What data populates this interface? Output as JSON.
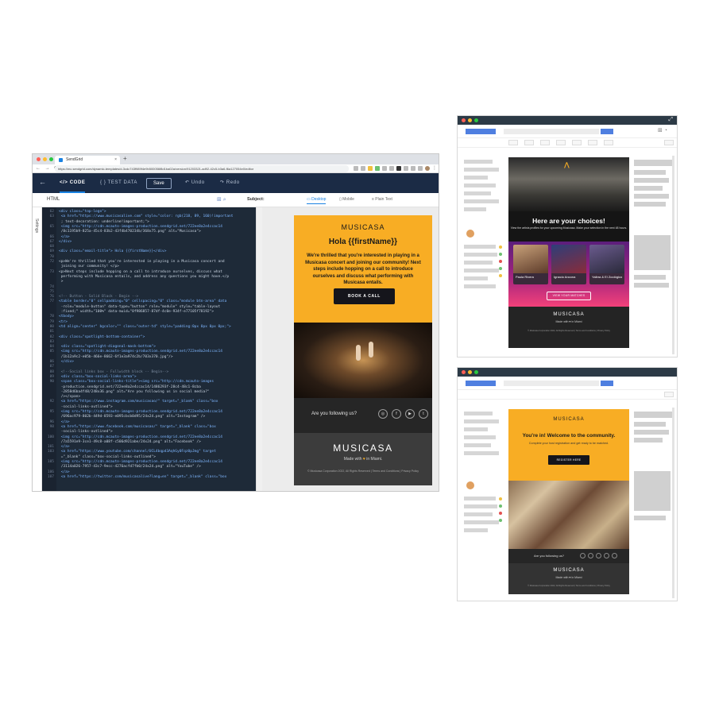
{
  "browser": {
    "tab_title": "SendGrid",
    "tab_close": "×",
    "new_tab": "+",
    "nav": "← → ⟳",
    "url": "https://mc.sendgrid.com/dynamic-templates/d-3cdc743f989f4e9b500056f8d1ba02a/version/91203321-ad92-42c5-b3a6-f6a127054e0/editor"
  },
  "toolbar": {
    "back": "←",
    "code_tab": "</>  CODE",
    "test_data_tab": "{ }  TEST DATA",
    "save_label": "Save",
    "undo_label": "↶  Undo",
    "redo_label": "↷  Redo"
  },
  "subbar": {
    "html_label": "HTML",
    "icons": "⊞  ⌕",
    "subject_label": "Subject:",
    "desktop": "▭  Desktop",
    "mobile": "▯  Mobile",
    "plain_text": "≡  Plain Text"
  },
  "settings_label": "Settings",
  "code_lines": [
    {
      "n": "62",
      "t": "<div class=\"top-logo\">",
      "k": "tag"
    },
    {
      "n": "63",
      "t": "  <a href=\"https://www.musicasalive.com\" style=\"color: rgb(218, 89, 160)!important",
      "k": "tag"
    },
    {
      "n": "",
      "t": "      ; text-decoration: underline!important;\">",
      "k": ""
    },
    {
      "n": "65",
      "t": "    <img src=\"http://cdn.mcauto-images-production.sendgrid.net/722ee8a2e4ccac14",
      "k": "tag"
    },
    {
      "n": "",
      "t": "      /8c1195b9-825a-45c4-83b2-43f4b470234b/368x75.png\" alt=\"Musicasa\">",
      "k": ""
    },
    {
      "n": "66",
      "t": "  </a>",
      "k": "tag"
    },
    {
      "n": "67",
      "t": "</div>",
      "k": "tag"
    },
    {
      "n": "68",
      "t": "",
      "k": ""
    },
    {
      "n": "69",
      "t": "<div class=\"email-title\"> Hola {{firstName}}</div>",
      "k": "tag"
    },
    {
      "n": "70",
      "t": "",
      "k": ""
    },
    {
      "n": "72",
      "t": "<p>We're thrilled that you're interested in playing in a Musicasa concert and",
      "k": ""
    },
    {
      "n": "",
      "t": "    joining our community! </p>",
      "k": ""
    },
    {
      "n": "73",
      "t": "<p>Next steps include hopping on a call to introduce ourselves, discuss what",
      "k": ""
    },
    {
      "n": "",
      "t": "    performing with Musicasa entails, and address any questions you might have.</p",
      "k": ""
    },
    {
      "n": "",
      "t": "    >",
      "k": ""
    },
    {
      "n": "74",
      "t": "",
      "k": ""
    },
    {
      "n": "75",
      "t": "",
      "k": ""
    },
    {
      "n": "76",
      "t": "<!-- Button - Solid Black - Begin -->",
      "k": "cm"
    },
    {
      "n": "77",
      "t": "<table border=\"0\" cellpadding=\"0\" cellspacing=\"0\" class=\"module btn-area\" data",
      "k": "tag"
    },
    {
      "n": "",
      "t": "    -role=\"module-button\" data-type=\"button\" role=\"module\" style=\"table-layout",
      "k": ""
    },
    {
      "n": "",
      "t": "    :fixed;\" width=\"100%\" data-muid=\"0f986857-87df-4c0e-934f-e77105f78192\">",
      "k": ""
    },
    {
      "n": "78",
      "t": "<tbody>",
      "k": "tag"
    },
    {
      "n": "79",
      "t": "<tr>",
      "k": "tag"
    },
    {
      "n": "80",
      "t": "<td align=\"center\" bgcolor=\"\" class=\"outer-td\" style=\"padding:0px 0px 0px 0px;\">",
      "k": "tag"
    },
    {
      "n": "81",
      "t": "",
      "k": ""
    },
    {
      "n": "82",
      "t": "<div class=\"spotlight-bottom-container\">",
      "k": "tag"
    },
    {
      "n": "83",
      "t": "",
      "k": ""
    },
    {
      "n": "84",
      "t": "  <div class=\"spotlight-diagonal-mask-bottom\">",
      "k": "tag"
    },
    {
      "n": "85",
      "t": "    <img src=\"http://cdn.mcauto-images-production.sendgrid.net/722ee8a2e4ccac14",
      "k": "tag"
    },
    {
      "n": "",
      "t": "      /1b12a9c2-e05b-466e-8662-6f1e3a974c2b/703x370.jpg\"/>",
      "k": ""
    },
    {
      "n": "86",
      "t": "  </div>",
      "k": "tag"
    },
    {
      "n": "87",
      "t": "",
      "k": ""
    },
    {
      "n": "88",
      "t": "  <!--Social links box - Fullwidth block -- Begin-->",
      "k": "cm"
    },
    {
      "n": "89",
      "t": "  <div class=\"box-social-links-area\">",
      "k": "tag"
    },
    {
      "n": "90",
      "t": "    <span class=\"box-social-links-title\"><img src=\"http://cdn.mcauto-images",
      "k": "tag"
    },
    {
      "n": "",
      "t": "      -production.sendgrid.net/722ee8a2e4ccac14/1486293f-28c4-48c1-8cba",
      "k": ""
    },
    {
      "n": "",
      "t": "      -2858d6ba4f48/248x36.png\" alt=\"Are you following us in social media?\"",
      "k": ""
    },
    {
      "n": "",
      "t": "      /></span>",
      "k": ""
    },
    {
      "n": "92",
      "t": "    <a href=\"https://www.instagram.com/musicasao/\" target=\"_blank\" class=\"box",
      "k": "tag"
    },
    {
      "n": "",
      "t": "      -social-links-outlined\">",
      "k": ""
    },
    {
      "n": "95",
      "t": "    <img src=\"http://cdn.mcauto-images-production.sendgrid.net/722ee8a2e4ccac14",
      "k": "tag"
    },
    {
      "n": "",
      "t": "      /696ac979-802b-449d-8593-e095cbcb0d95/24x24.png\" alt=\"Instagram\" />",
      "k": ""
    },
    {
      "n": "96",
      "t": "    </a>",
      "k": "tag"
    },
    {
      "n": "98",
      "t": "    <a href=\"https://www.facebook.com/musicasao/\" target=\"_blank\" class=\"box",
      "k": "tag"
    },
    {
      "n": "",
      "t": "      -social-links-outlined\">",
      "k": ""
    },
    {
      "n": "100",
      "t": "    <img src=\"http://cdn.mcauto-images-production.sendgrid.net/722ee8a2e4ccac14",
      "k": "tag"
    },
    {
      "n": "",
      "t": "      /7a5591e9-3ce1-49c8-a08f-c506d921abe/24x24.png\" alt=\"Facebook\" />",
      "k": ""
    },
    {
      "n": "101",
      "t": "    </a>",
      "k": "tag"
    },
    {
      "n": "103",
      "t": "    <a href=\"https://www.youtube.com/channel/UCL4bqpd3AqhGy0Fqz0pJmg\" target",
      "k": "tag"
    },
    {
      "n": "",
      "t": "      =\"_blank\" class=\"box-social-links-outlined\">",
      "k": ""
    },
    {
      "n": "105",
      "t": "    <img src=\"http://cdn.mcauto-images-production.sendgrid.net/722ee8a2e4ccac14",
      "k": "tag"
    },
    {
      "n": "",
      "t": "      /3114a026-7957-43c7-9ecc-4276acfd7fb0/24x24.png\" alt=\"YouTube\" />",
      "k": ""
    },
    {
      "n": "106",
      "t": "    </a>",
      "k": "tag"
    },
    {
      "n": "107",
      "t": "    <a href=\"https://twitter.com/musicasalive?lang=en\" target=\"_blank\" class=\"box",
      "k": "tag"
    }
  ],
  "email": {
    "logo": "MUSICASA",
    "title": "Hola {{firstName}}",
    "body": "We're thrilled that you're interested in playing in a Musicasa concert and joining our community! Next steps include hopping on a call to introduce ourselves and discuss what performing with Musicasa entails.",
    "button": "BOOK A CALL",
    "social_text": "Are you following us?",
    "footer_logo": "MUSICASA",
    "made_prefix": "Made with",
    "made_suffix": "in Miami.",
    "legal": "© Musicasa Corporation 2022, All Rights Reserved   |   Terms and Conditions   |   Privacy Policy"
  },
  "mini_a": {
    "title": "Here are your choices!",
    "subtitle": "View the artists profiles for your upcoming Musicasa. Make your selection in the next 48 hours.",
    "artists": [
      {
        "name": "Paula Rivera"
      },
      {
        "name": "Ignacio Ancona"
      },
      {
        "name": "Yalbra & El Zoológico"
      }
    ],
    "button": "VIEW YOUR MATCHES",
    "footer_logo": "MUSICASA",
    "made": "Made with ♥ in Miami",
    "legal": "© Musicasa Corporation 2022, All Rights Reserved   |   Terms and Conditions   |   Privacy Policy"
  },
  "mini_b": {
    "logo": "MUSICASA",
    "title": "You're in! Welcome to the community.",
    "subtitle": "Complete your host registration and get ready to be matched.",
    "button": "REGISTER HERE",
    "social_text": "Are you following us?",
    "footer_logo": "MUSICASA",
    "made": "Made with ♥ in Miami",
    "legal": "© Musicasa Corporation 2022, All Rights Reserved   |   Terms and Conditions   |   Privacy Policy"
  },
  "colors": {
    "accent_orange": "#f8ad24",
    "navy_toolbar": "#1b2b45",
    "link_blue": "#1a82e2",
    "magenta": "#a4247e"
  }
}
